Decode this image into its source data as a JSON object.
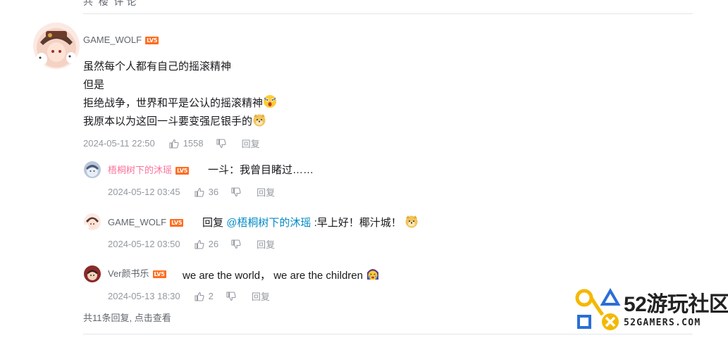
{
  "top_cut_text": "共  楼  评 论",
  "main_comment": {
    "username": "GAME_WOLF",
    "level": "LV5",
    "lines": [
      "虽然每个人都有自己的摇滚精神",
      "但是",
      "拒绝战争，世界和平是公认的摇滚精神",
      "我原本以为这回一斗要变强尼银手的"
    ],
    "time": "2024-05-11 22:50",
    "likes": "1558",
    "reply_label": "回复"
  },
  "replies": [
    {
      "username": "梧桐树下的沐瑶",
      "level": "LV5",
      "text": "一斗：我曾目睹过……",
      "time": "2024-05-12 03:45",
      "likes": "36",
      "reply_label": "回复"
    },
    {
      "username": "GAME_WOLF",
      "level": "LV5",
      "prefix": "回复",
      "mention": "@梧桐树下的沐瑶",
      "text": ":早上好！椰汁城！",
      "time": "2024-05-12 03:50",
      "likes": "26",
      "reply_label": "回复"
    },
    {
      "username": "Ver颜书乐",
      "level": "LV5",
      "text": "we are the world， we are the children",
      "time": "2024-05-13 18:30",
      "likes": "2",
      "reply_label": "回复"
    }
  ],
  "view_more": "共11条回复, 点击查看",
  "watermark": {
    "title": "52游玩社区",
    "subtitle": "52GAMERS.COM"
  },
  "colors": {
    "mention": "#008ac5",
    "level_badge": "#ff6d1f",
    "pink_name": "#fb7299",
    "meta_gray": "#9499a0"
  },
  "icons": [
    "thumb-up-icon",
    "thumb-down-icon",
    "shocked-emoji",
    "doge-emoji",
    "crying-emoji"
  ]
}
